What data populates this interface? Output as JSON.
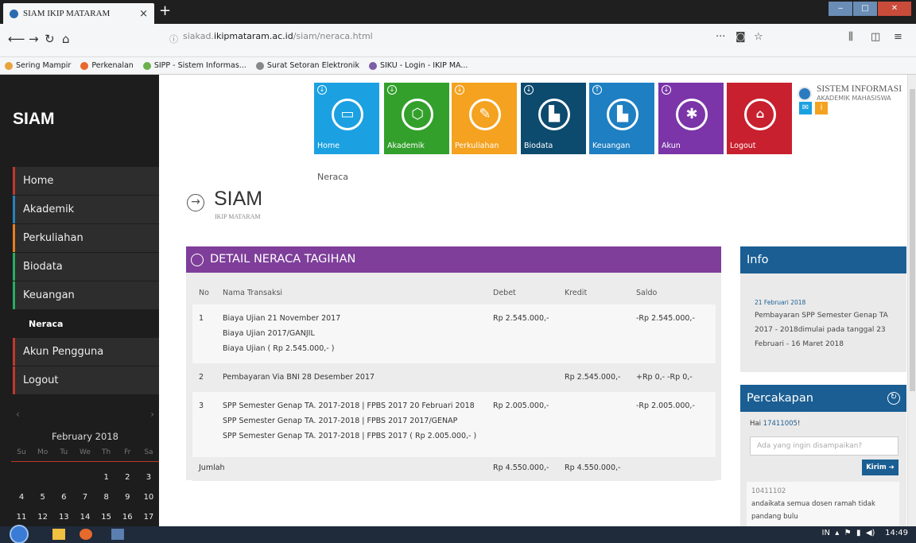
{
  "browser": {
    "tab_title": "SIAM IKIP MATARAM",
    "tab_close": "×",
    "new_tab": "+",
    "url_prefix": "siakad.",
    "url_domain": "ikipmataram.ac.id",
    "url_path": "/siam/neraca.html",
    "nav_icons": [
      "back-icon",
      "forward-icon",
      "reload-icon",
      "home-icon"
    ],
    "right_icons": [
      "more-icon",
      "pocket-icon",
      "star-icon",
      "library-icon",
      "sidebar-icon",
      "menu-icon"
    ],
    "bookmarks": [
      {
        "label": "Sering Mampir",
        "color": "#e8a33b"
      },
      {
        "label": "Perkenalan",
        "color": "#e66a2c"
      },
      {
        "label": "SIPP - Sistem Informas...",
        "color": "#6ab04c"
      },
      {
        "label": "Surat Setoran Elektronik",
        "color": "#888888"
      },
      {
        "label": "SIKU - Login - IKIP MA...",
        "color": "#7b5ea7"
      }
    ]
  },
  "sidebar": {
    "brand": "SIAM",
    "items": [
      {
        "label": "Home",
        "accent": "#c0392b"
      },
      {
        "label": "Akademik",
        "accent": "#2980b9"
      },
      {
        "label": "Perkuliahan",
        "accent": "#e67e22"
      },
      {
        "label": "Biodata",
        "accent": "#27ae60"
      },
      {
        "label": "Keuangan",
        "accent": "#27ae60"
      },
      {
        "label": "Neraca",
        "accent": ""
      },
      {
        "label": "Akun Pengguna",
        "accent": "#c0392b"
      },
      {
        "label": "Logout",
        "accent": "#c0392b"
      }
    ],
    "calendar": {
      "month": "February 2018",
      "prev": "‹",
      "next": "›",
      "days": [
        "Su",
        "Mo",
        "Tu",
        "We",
        "Th",
        "Fr",
        "Sa"
      ],
      "rows": [
        [
          "",
          "",
          "",
          "",
          "1",
          "2",
          "3"
        ],
        [
          "4",
          "5",
          "6",
          "7",
          "8",
          "9",
          "10"
        ],
        [
          "11",
          "12",
          "13",
          "14",
          "15",
          "16",
          "17"
        ]
      ]
    }
  },
  "tiles": [
    {
      "label": "Home",
      "color": "#1ba1e2",
      "icon": "monitor-icon",
      "glyph": "▭"
    },
    {
      "label": "Akademik",
      "color": "#33a02c",
      "icon": "box-icon",
      "glyph": "⬡"
    },
    {
      "label": "Perkuliahan",
      "color": "#f4a21f",
      "icon": "pencil-icon",
      "glyph": "✎"
    },
    {
      "label": "Biodata",
      "color": "#0c4a6e",
      "icon": "chart-icon",
      "glyph": "▙"
    },
    {
      "label": "Keuangan",
      "color": "#1e7fc2",
      "icon": "chart-icon",
      "glyph": "▙"
    },
    {
      "label": "Akun",
      "color": "#7b35a8",
      "icon": "gear-icon",
      "glyph": "✱"
    },
    {
      "label": "Logout",
      "color": "#c8202e",
      "icon": "unlock-icon",
      "glyph": "🔓"
    }
  ],
  "brand_right": {
    "title": "SISTEM INFORMASI",
    "subtitle": "AKADEMIK MAHASISWA",
    "mail_color": "#1ba1e2",
    "info_color": "#f4a21f"
  },
  "page": {
    "breadcrumb": "Neraca",
    "title": "SIAM",
    "subtitle": "IKIP MATARAM"
  },
  "neraca": {
    "title": "DETAIL NERACA TAGIHAN",
    "columns": [
      "No",
      "Nama Transaksi",
      "Debet",
      "Kredit",
      "Saldo"
    ],
    "rows": [
      {
        "no": "1",
        "name": [
          "Biaya Ujian 21 November 2017",
          "Biaya Ujian 2017/GANJIL",
          "Biaya Ujian ( Rp 2.545.000,- )"
        ],
        "debet": "Rp 2.545.000,-",
        "kredit": "",
        "saldo": "-Rp 2.545.000,-"
      },
      {
        "no": "2",
        "name": [
          "Pembayaran Via BNI 28 Desember 2017"
        ],
        "debet": "",
        "kredit": "Rp 2.545.000,-",
        "saldo": "+Rp 0,- -Rp 0,-"
      },
      {
        "no": "3",
        "name": [
          "SPP Semester Genap TA. 2017-2018 | FPBS 2017 20 Februari 2018",
          "SPP Semester Genap TA. 2017-2018 | FPBS 2017 2017/GENAP",
          "SPP Semester Genap TA. 2017-2018 | FPBS 2017 ( Rp 2.005.000,- )"
        ],
        "debet": "Rp 2.005.000,-",
        "kredit": "",
        "saldo": "-Rp 2.005.000,-"
      }
    ],
    "total_label": "Jumlah",
    "total_debet": "Rp 4.550.000,-",
    "total_kredit": "Rp 4.550.000,-"
  },
  "info": {
    "title": "Info",
    "date": "21 Februari 2018",
    "text": "Pembayaran SPP Semester Genap TA 2017 - 2018dimulai pada tanggal 23 Februari - 16 Maret 2018"
  },
  "chat": {
    "title": "Percakapan",
    "greeting_prefix": "Hai ",
    "user": "17411005",
    "greeting_suffix": "!",
    "placeholder": "Ada yang ingin disampaikan?",
    "send": "Kirim",
    "msg_user": "10411102",
    "msg_text": "andaikata semua dosen ramah tidak pandang bulu"
  },
  "taskbar": {
    "lang": "IN",
    "time": "14:49"
  }
}
